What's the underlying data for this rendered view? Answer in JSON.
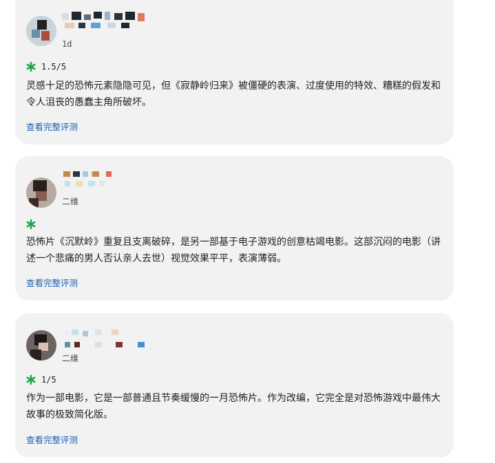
{
  "reviews": [
    {
      "time": "1d",
      "score": "1.5/5",
      "text": "灵感十足的恐怖元素隐隐可见，但《寂静岭归来》被僵硬的表演、过度使用的特效、糟糕的假发和令人沮丧的愚蠢主角所破坏。",
      "link": "查看完整评测"
    },
    {
      "time": "二维",
      "score": "",
      "text": "恐怖片《沉默岭》重复且支离破碎，是另一部基于电子游戏的创意枯竭电影。这部沉闷的电影（讲述一个悲痛的男人否认亲人去世）视觉效果平平，表演薄弱。",
      "link": "查看完整评测"
    },
    {
      "time": "二维",
      "score": "1/5",
      "text": "作为一部电影，它是一部普通且节奏缓慢的一月恐怖片。作为改编，它完全是对恐怖游戏中最伟大故事的极致简化版。",
      "link": "查看完整评测"
    }
  ],
  "icons": {
    "rating": "asterisk-icon"
  },
  "colors": {
    "rating_green": "#1aa84a",
    "link_blue": "#1a5fb4",
    "card_bg": "#f2f2f2"
  }
}
